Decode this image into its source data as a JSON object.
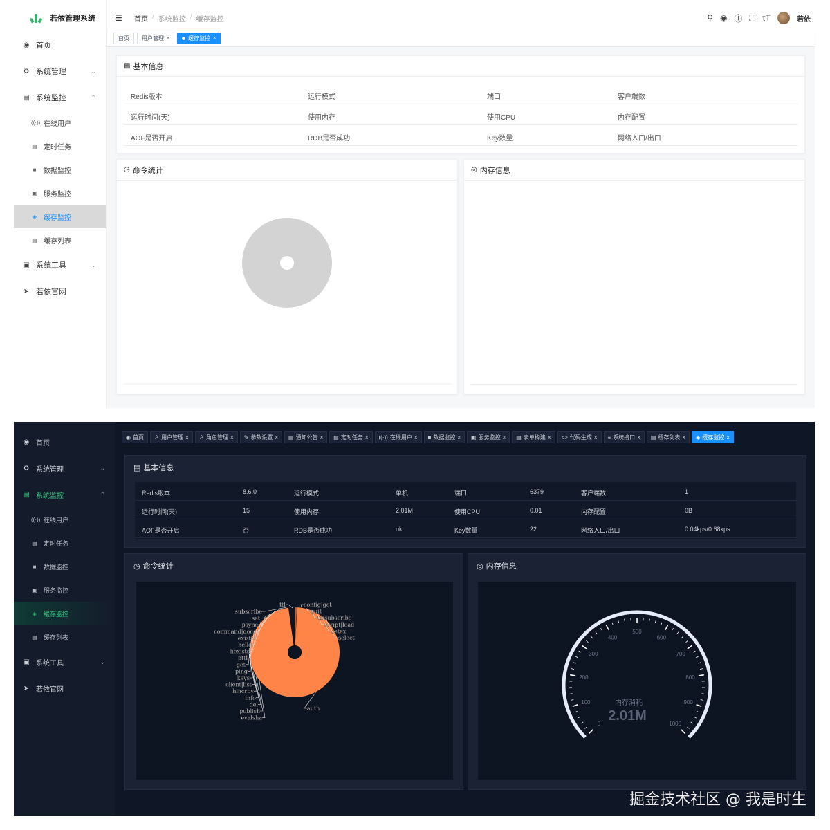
{
  "light": {
    "app_title": "若依管理系统",
    "sidebar": {
      "home": "首页",
      "sys_manage": "系统管理",
      "sys_monitor": "系统监控",
      "sub": [
        "在线用户",
        "定时任务",
        "数据监控",
        "服务监控",
        "缓存监控",
        "缓存列表"
      ],
      "sys_tools": "系统工具",
      "website": "若依官网"
    },
    "breadcrumb": [
      "首页",
      "系统监控",
      "缓存监控"
    ],
    "user_name": "若依",
    "tags": [
      "首页",
      "用户管理",
      "缓存监控"
    ],
    "basic_info": {
      "title": "基本信息",
      "rows": [
        [
          "Redis版本",
          "运行模式",
          "端口",
          "客户端数"
        ],
        [
          "运行时间(天)",
          "使用内存",
          "使用CPU",
          "内存配置"
        ],
        [
          "AOF是否开启",
          "RDB是否成功",
          "Key数量",
          "网络入口/出口"
        ]
      ]
    },
    "cmd_stats_title": "命令统计",
    "memory_title": "内存信息"
  },
  "dark": {
    "sidebar": {
      "home": "首页",
      "sys_manage": "系统管理",
      "sys_monitor": "系统监控",
      "sub": [
        "在线用户",
        "定时任务",
        "数据监控",
        "服务监控",
        "缓存监控",
        "缓存列表"
      ],
      "sys_tools": "系统工具",
      "website": "若依官网"
    },
    "tags": [
      "首页",
      "用户管理",
      "角色管理",
      "参数设置",
      "通知公告",
      "定时任务",
      "在线用户",
      "数据监控",
      "服务监控",
      "表单构建",
      "代码生成",
      "系统接口",
      "缓存列表",
      "缓存监控"
    ],
    "basic_info": {
      "title": "基本信息",
      "rows": [
        [
          "Redis版本",
          "8.6.0",
          "运行模式",
          "单机",
          "端口",
          "6379",
          "客户端数",
          "1"
        ],
        [
          "运行时间(天)",
          "15",
          "使用内存",
          "2.01M",
          "使用CPU",
          "0.01",
          "内存配置",
          "0B"
        ],
        [
          "AOF是否开启",
          "否",
          "RDB是否成功",
          "ok",
          "Key数量",
          "22",
          "网络入口/出口",
          "0.04kps/0.68kps"
        ]
      ]
    },
    "cmd_stats_title": "命令统计",
    "memory_title": "内存信息",
    "pie_labels": [
      "ttl",
      "config|get",
      "quit",
      "unsubscribe",
      "script|load",
      "setex",
      "select",
      "subscribe",
      "set",
      "psync",
      "command|docs",
      "exists",
      "hello",
      "hexists",
      "pttl",
      "get",
      "ping",
      "keys",
      "client|list",
      "hincrby",
      "info",
      "del",
      "publish",
      "evalsha",
      "auth"
    ],
    "gauge": {
      "label": "内存消耗",
      "value_text": "2.01M",
      "value": 2.01,
      "ticks": [
        "0",
        "100",
        "200",
        "300",
        "400",
        "500",
        "600",
        "700",
        "800",
        "900",
        "1000"
      ]
    },
    "watermark": "掘金技术社区 @ 我是时生"
  },
  "colors": {
    "accent": "#1890ff",
    "green": "#30c27a",
    "pie": "#ff8447",
    "gauge": "#5470c6"
  }
}
